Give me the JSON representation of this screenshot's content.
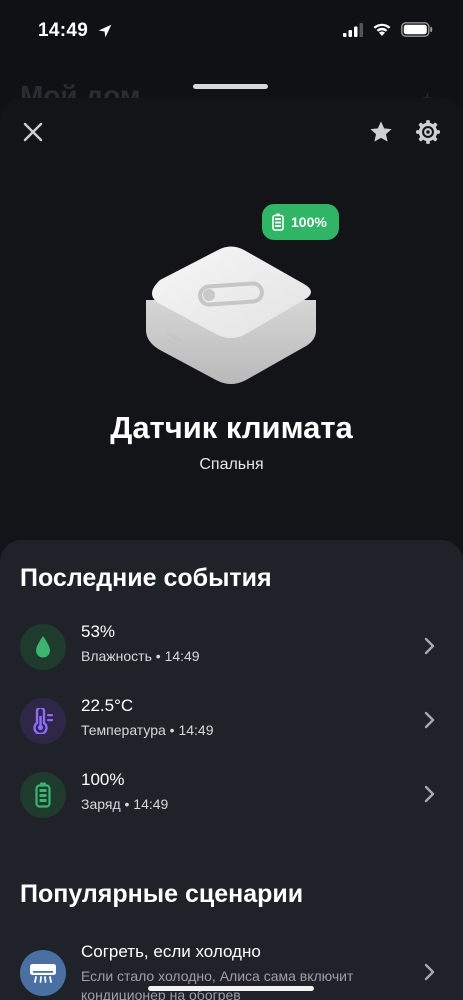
{
  "status_bar": {
    "time": "14:49"
  },
  "background_screen": {
    "title": "Мой дом"
  },
  "header": {
    "close": "close",
    "favorite": "star",
    "settings": "gear"
  },
  "device": {
    "battery_badge": "100%",
    "name": "Датчик климата",
    "room": "Спальня"
  },
  "events": {
    "title": "Последние события",
    "items": [
      {
        "value": "53%",
        "subtitle": "Влажность • 14:49",
        "icon": "droplet-icon",
        "color": "#3cb371"
      },
      {
        "value": "22.5°C",
        "subtitle": "Температура • 14:49",
        "icon": "thermometer-icon",
        "color": "#8f6bff"
      },
      {
        "value": "100%",
        "subtitle": "Заряд • 14:49",
        "icon": "battery-icon",
        "color": "#3cb371"
      }
    ]
  },
  "scenarios": {
    "title": "Популярные сценарии",
    "items": [
      {
        "title": "Согреть, если холодно",
        "description": "Если стало холодно, Алиса сама включит кондиционер на обогрев",
        "icon": "air-conditioner-icon"
      }
    ]
  },
  "colors": {
    "accent_green": "#2fb565",
    "background": "#121418",
    "panel": "#1f2229"
  }
}
